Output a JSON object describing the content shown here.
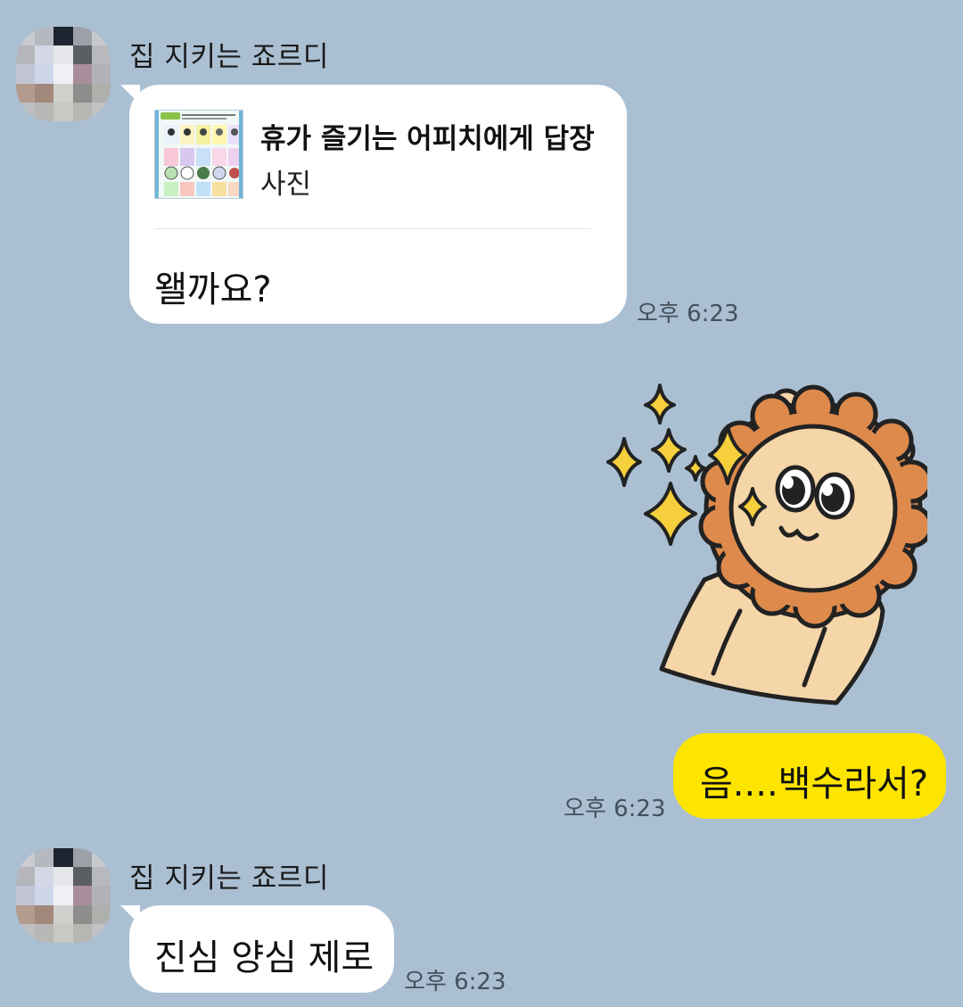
{
  "messages": {
    "m1": {
      "sender": "집 지키는 죠르디",
      "reply_title": "휴가 즐기는 어피치에게 답장",
      "reply_type": "사진",
      "text": "왤까요?",
      "time": "오후 6:23"
    },
    "m2": {
      "sticker": "lion-sticker",
      "text": "음....백수라서?",
      "time": "오후 6:23"
    },
    "m3": {
      "sender": "집 지키는 죠르디",
      "text": "진심 양심 제로",
      "time": "오후 6:23"
    }
  },
  "colors": {
    "background": "#aabfd2",
    "incoming_bubble": "#ffffff",
    "outgoing_bubble": "#fee500"
  }
}
